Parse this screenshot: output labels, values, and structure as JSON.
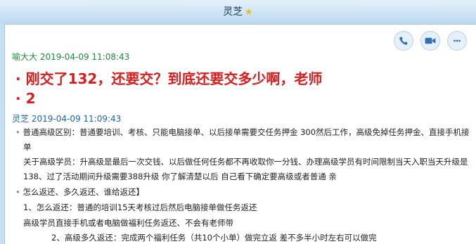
{
  "window": {
    "title": "灵芝",
    "title_star": "★"
  },
  "toolbar": {
    "call_icon": "phone-icon",
    "video_icon": "video-icon",
    "more_icon": "more-icon"
  },
  "messages": [
    {
      "sender": "喻大大",
      "timestamp": "2019-04-09 11:08:43",
      "lines": [
        "刚交了132，还要交？到底还要交多少啊，老师",
        "2"
      ]
    },
    {
      "sender": "灵芝",
      "timestamp": "2019-04-09 11:09:43",
      "lines": [
        "普通高级区别：普通要培训、考核、只能电脑接单、以后接单需要交任务押金  300然后工作，高级免掉任务押金、直接手机接",
        "单",
        "关于高级学员：升高级是最后一次交钱、以后做任何任务都不再收取你一分钱、办理高级学员有时间限制当天入职当天升级是",
        "138、过了活动期间升级需要388升级   你了解清楚以后 自己看下确定要高级或者普通 亲",
        "怎么返还、多久返还、谁给返还】",
        "1、怎么返还：普通的培训15天考核过后然后电脑接单做任务返还",
        "高级学员直接手机或者电脑做福利任务返还、不会有老师带",
        "2、高级多久返还：完成两个福利任务（共10个小单）做完立返 差不多半小时左右可以做完"
      ]
    }
  ],
  "colors": {
    "title_bg": "#bcd9f0",
    "sender1": "#1f8a3b",
    "sender2": "#1d63b3",
    "emphasis": "#d81e1e"
  }
}
